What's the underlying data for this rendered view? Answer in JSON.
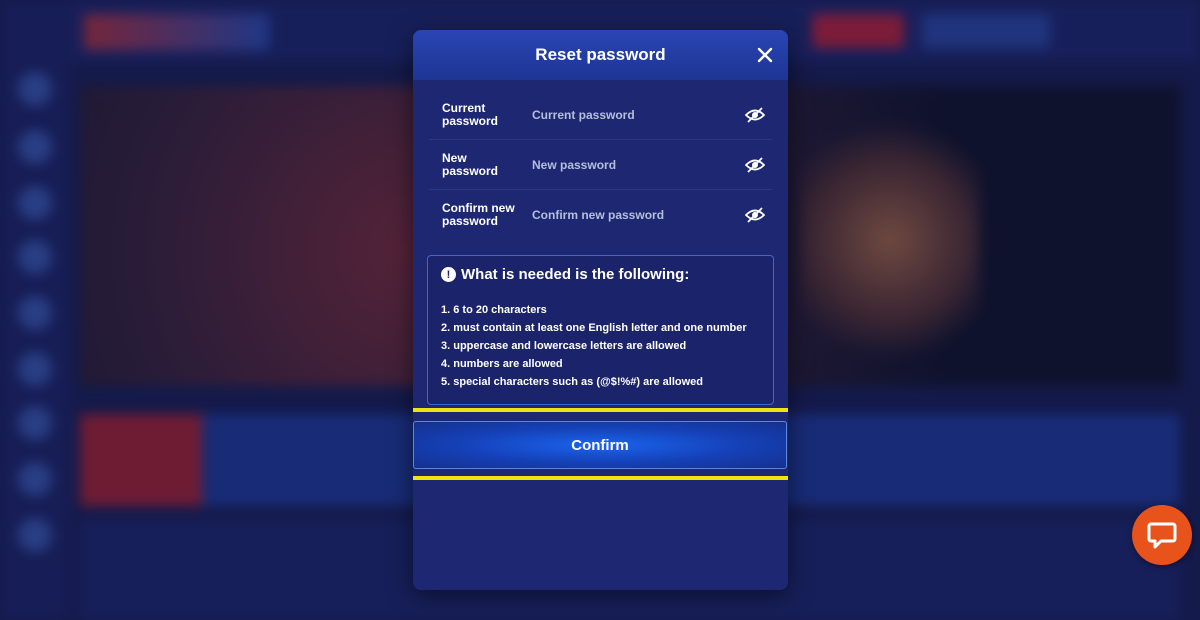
{
  "modal": {
    "title": "Reset password",
    "fields": [
      {
        "label": "Current password",
        "placeholder": "Current password"
      },
      {
        "label": "New password",
        "placeholder": "New password"
      },
      {
        "label": "Confirm new password",
        "placeholder": "Confirm new password"
      }
    ],
    "requirements": {
      "title": "What is needed is the following:",
      "items": [
        "1. 6 to 20 characters",
        "2. must contain at least one English letter and one number",
        "3. uppercase and lowercase letters are allowed",
        "4. numbers are allowed",
        "5. special characters such as (@$!%#) are allowed"
      ]
    },
    "confirm_label": "Confirm"
  },
  "icons": {
    "close": "close-icon",
    "eye": "eye-slash-icon",
    "info": "info-icon",
    "chat": "chat-icon"
  },
  "colors": {
    "modal_bg": "#1e2872",
    "header_bg": "#2a45b4",
    "highlight": "#f1e30f",
    "confirm_button": "#1a64ee",
    "chat_button": "#e8531c"
  }
}
